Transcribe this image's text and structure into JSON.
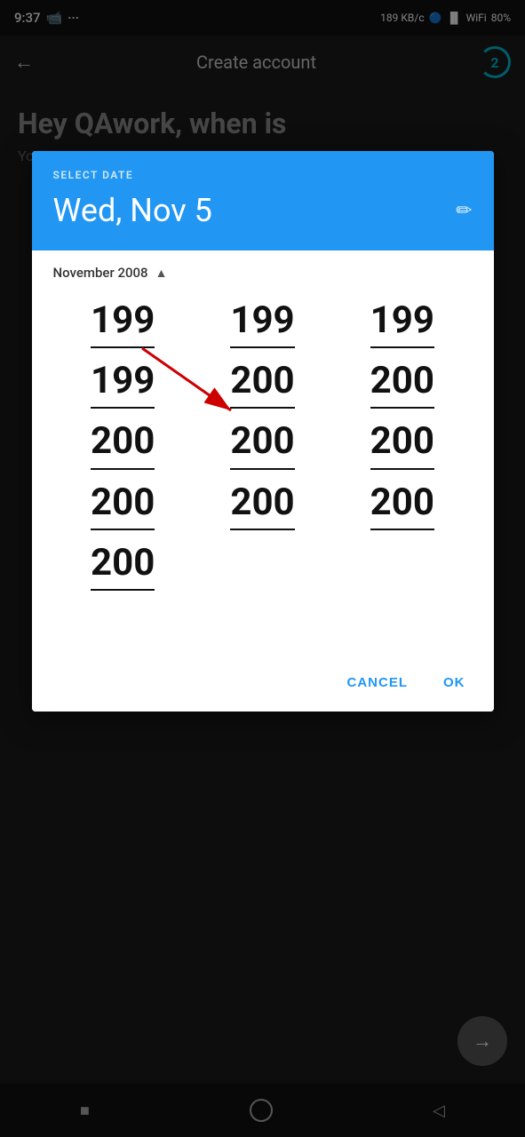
{
  "statusBar": {
    "time": "9:37",
    "videoIcon": "▶",
    "dotsIcon": "···",
    "networkSpeed": "189 KB/c",
    "bluetoothIcon": "bluetooth",
    "signalIcon": "signal",
    "wifiIcon": "wifi",
    "batteryPercent": "80%"
  },
  "topNav": {
    "backLabel": "←",
    "title": "Create account",
    "stepLabel": "2"
  },
  "background": {
    "headline": "Hey QAwork, when is",
    "subtext": "Yo"
  },
  "dialog": {
    "selectDateLabel": "SELECT DATE",
    "selectedDate": "Wed, Nov 5",
    "editIconLabel": "✏",
    "monthYear": "November 2008",
    "chevron": "▲",
    "yearColumns": [
      [
        "199",
        "199",
        "200",
        "200",
        "200"
      ],
      [
        "199",
        "200",
        "200",
        "200"
      ],
      [
        "199",
        "200",
        "200",
        "200"
      ]
    ],
    "yearData": {
      "col1": [
        {
          "value": "199",
          "underlined": true
        },
        {
          "value": "199",
          "underlined": true
        },
        {
          "value": "200",
          "underlined": true
        },
        {
          "value": "200",
          "underlined": true
        },
        {
          "value": "200",
          "underlined": true
        }
      ],
      "col2": [
        {
          "value": "199",
          "underlined": true
        },
        {
          "value": "200",
          "underlined": true
        },
        {
          "value": "200",
          "underlined": true
        },
        {
          "value": "200",
          "underlined": true
        }
      ],
      "col3": [
        {
          "value": "199",
          "underlined": true
        },
        {
          "value": "200",
          "underlined": true
        },
        {
          "value": "200",
          "underlined": true
        },
        {
          "value": "200",
          "underlined": true
        }
      ]
    },
    "cancelLabel": "CANCEL",
    "okLabel": "OK"
  },
  "fab": {
    "icon": "→"
  },
  "bottomNav": {
    "squareIcon": "■",
    "circleIcon": "○",
    "backIcon": "◁"
  }
}
